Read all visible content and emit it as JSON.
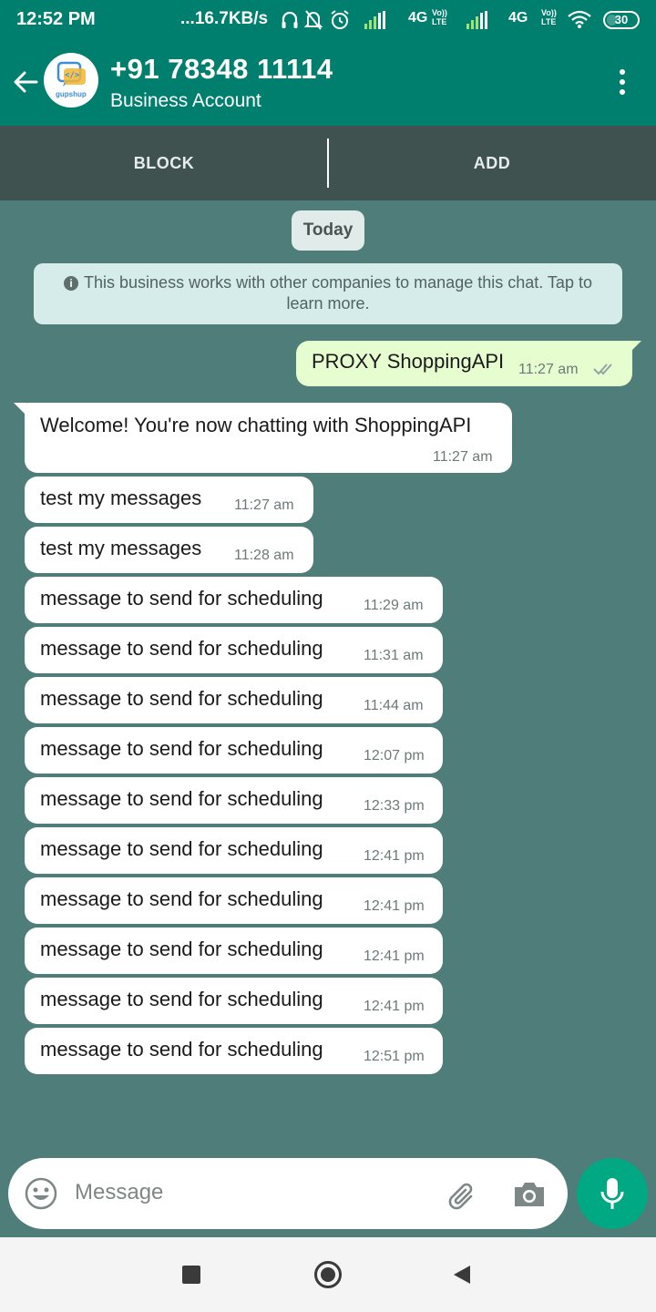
{
  "status_bar": {
    "time": "12:52 PM",
    "speed": "...16.7KB/s",
    "network1": "4G",
    "network2": "4G",
    "volte": "Vo)) LTE",
    "battery": "30"
  },
  "header": {
    "contact_name": "+91 78348 11114",
    "subtitle": "Business Account",
    "avatar_logo_text": "gupshup"
  },
  "action_bar": {
    "block_label": "BLOCK",
    "add_label": "ADD"
  },
  "chat": {
    "date_label": "Today",
    "notice": "This business works with other companies to manage this chat. Tap to learn more.",
    "outgoing": {
      "text": "PROXY ShoppingAPI",
      "time": "11:27 am",
      "status": "read"
    },
    "incoming": [
      {
        "text": "Welcome! You're now chatting with ShoppingAPI",
        "time": "11:27 am"
      },
      {
        "text": "test my messages",
        "time": "11:27 am"
      },
      {
        "text": "test my messages",
        "time": "11:28 am"
      },
      {
        "text": "message to send for scheduling",
        "time": "11:29 am"
      },
      {
        "text": "message to send for scheduling",
        "time": "11:31 am"
      },
      {
        "text": "message to send for scheduling",
        "time": "11:44 am"
      },
      {
        "text": "message to send for scheduling",
        "time": "12:07 pm"
      },
      {
        "text": "message to send for scheduling",
        "time": "12:33 pm"
      },
      {
        "text": "message to send for scheduling",
        "time": "12:41 pm"
      },
      {
        "text": "message to send for scheduling",
        "time": "12:41 pm"
      },
      {
        "text": "message to send for scheduling",
        "time": "12:41 pm"
      },
      {
        "text": "message to send for scheduling",
        "time": "12:41 pm"
      },
      {
        "text": "message to send for scheduling",
        "time": "12:51 pm"
      }
    ]
  },
  "composer": {
    "placeholder": "Message",
    "icons": [
      "emoji-icon",
      "attach-icon",
      "camera-icon",
      "mic-icon"
    ]
  },
  "colors": {
    "header": "#007e6e",
    "chat_background": "#4f7d79",
    "outgoing_bubble": "#e6fdcf",
    "mic_button": "#00a884"
  }
}
